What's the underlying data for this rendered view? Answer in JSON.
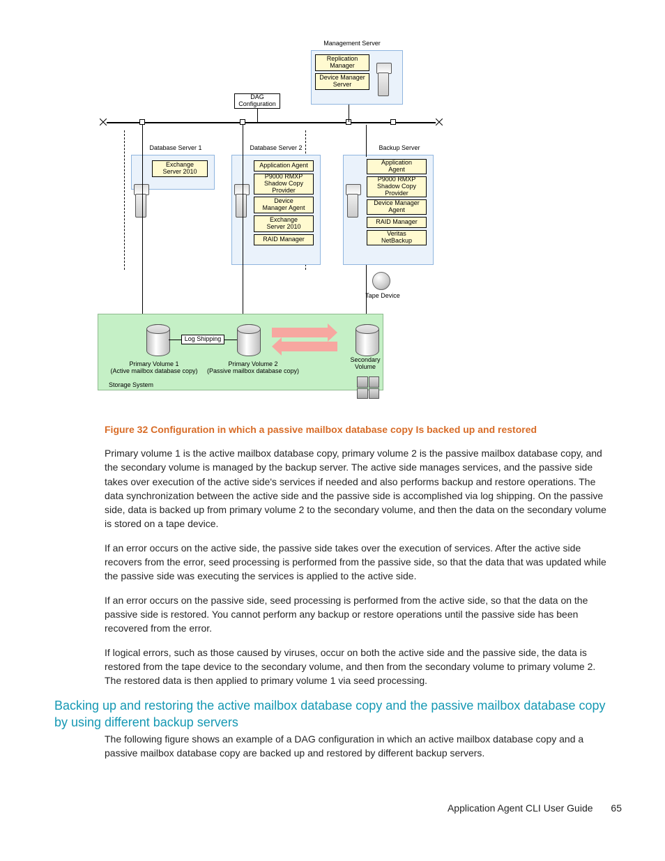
{
  "diagram": {
    "management_server_title": "Management Server",
    "replication_manager": "Replication\nManager",
    "device_manager_server": "Device Manager\nServer",
    "dag_configuration": "DAG\nConfiguration",
    "db_server_1": "Database Server 1",
    "db_server_2": "Database Server 2",
    "backup_server": "Backup Server",
    "exchange_server_2010_a": "Exchange\nServer 2010",
    "app_agent_2": "Application Agent",
    "app_agent_bk": "Application\nAgent",
    "shadow_copy_2": "P9000 RMXP\nShadow Copy\nProvider",
    "shadow_copy_bk": "P9000 RMXP\nShadow Copy\nProvider",
    "device_manager_agent_2": "Device\nManager Agent",
    "device_manager_agent_bk": "Device Manager\nAgent",
    "exchange_server_2010_2": "Exchange\nServer 2010",
    "raid_manager_2": "RAID Manager",
    "raid_manager_bk": "RAID Manager",
    "netbackup": "Veritas\nNetBackup",
    "tape_device": "Tape Device",
    "log_shipping": "Log Shipping",
    "primary_vol1": "Primary Volume 1\n(Active mailbox database copy)",
    "primary_vol2": "Primary Volume 2\n(Passive mailbox database copy)",
    "secondary_vol": "Secondary\nVolume",
    "storage_system": "Storage System"
  },
  "figure_caption": "Figure 32 Configuration in which a passive mailbox database copy Is backed up and restored",
  "paragraphs": {
    "p1": "Primary volume 1 is the active mailbox database copy, primary volume 2 is the passive mailbox database copy, and the secondary volume is managed by the backup server. The active side manages services, and the passive side takes over execution of the active side's services if needed and also performs backup and restore operations. The data synchronization between the active side and the passive side is accomplished via log shipping. On the passive side, data is backed up from primary volume 2 to the secondary volume, and then the data on the secondary volume is stored on a tape device.",
    "p2": "If an error occurs on the active side, the passive side takes over the execution of services. After the active side recovers from the error, seed processing is performed from the passive side, so that the data that was updated while the passive side was executing the services is applied to the active side.",
    "p3": "If an error occurs on the passive side, seed processing is performed from the active side, so that the data on the passive side is restored. You cannot perform any backup or restore operations until the passive side has been recovered from the error.",
    "p4": "If logical errors, such as those caused by viruses, occur on both the active side and the passive side, the data is restored from the tape device to the secondary volume, and then from the secondary volume to primary volume 2. The restored data is then applied to primary volume 1 via seed processing."
  },
  "section_heading": "Backing up and restoring the active mailbox database copy and the passive mailbox database copy by using different backup servers",
  "p5": "The following figure shows an example of a DAG configuration in which an active mailbox database copy and a passive mailbox database copy are backed up and restored by different backup servers.",
  "footer_title": "Application Agent CLI User Guide",
  "page_number": "65"
}
